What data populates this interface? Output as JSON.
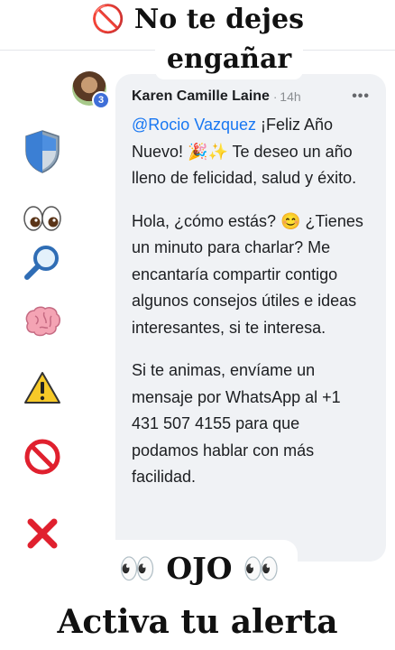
{
  "headline": {
    "line1": "🚫 No te dejes",
    "line2": "engañar"
  },
  "comment": {
    "author": "Karen Camille Laine",
    "separator": "·",
    "time": "14h",
    "more": "•••",
    "badge_count": "3",
    "mention": "@Rocio Vazquez",
    "para1_rest": " ¡Feliz Año Nuevo! 🎉✨ Te deseo un año lleno de felicidad, salud y éxito.",
    "para2": "Hola, ¿cómo estás? 😊 ¿Tienes un minuto para charlar? Me encantaría compartir contigo algunos consejos útiles e ideas interesantes, si te interesa.",
    "para3": "Si te animas, envíame un mensaje por WhatsApp al +1 431 507 4155 para que podamos hablar con más facilidad."
  },
  "footer": {
    "ojo": "👀 OJO 👀",
    "alerta": "Activa tu alerta"
  },
  "side_icons": [
    "shield-icon",
    "eyes-icon",
    "magnifier-icon",
    "brain-icon",
    "warning-icon",
    "prohibited-icon",
    "cross-mark-icon"
  ],
  "colors": {
    "card_bg": "#f0f2f5",
    "mention": "#1877f2",
    "badge": "#3f6fd8",
    "text": "#1c1e21"
  }
}
